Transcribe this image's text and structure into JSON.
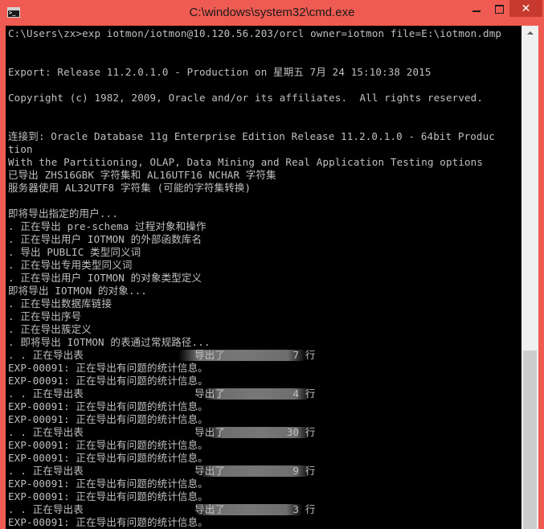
{
  "window": {
    "title": "C:\\windows\\system32\\cmd.exe",
    "icon": "cmd-console-icon",
    "controls": {
      "minimize_icon": "minimize-icon",
      "maximize_icon": "maximize-icon",
      "close_label": "✕"
    }
  },
  "console": {
    "lines": [
      "C:\\Users\\zx>exp iotmon/iotmon@10.120.56.203/orcl owner=iotmon file=E:\\iotmon.dmp",
      "",
      "",
      "Export: Release 11.2.0.1.0 - Production on 星期五 7月 24 15:10:38 2015",
      "",
      "Copyright (c) 1982, 2009, Oracle and/or its affiliates.  All rights reserved.",
      "",
      "",
      "连接到: Oracle Database 11g Enterprise Edition Release 11.2.0.1.0 - 64bit Produc",
      "tion",
      "With the Partitioning, OLAP, Data Mining and Real Application Testing options",
      "已导出 ZHS16GBK 字符集和 AL16UTF16 NCHAR 字符集",
      "服务器使用 AL32UTF8 字符集 (可能的字符集转换)",
      "",
      "即将导出指定的用户...",
      ". 正在导出 pre-schema 过程对象和操作",
      ". 正在导出用户 IOTMON 的外部函数库名",
      ". 导出 PUBLIC 类型同义词",
      ". 正在导出专用类型同义词",
      ". 正在导出用户 IOTMON 的对象类型定义",
      "即将导出 IOTMON 的对象...",
      ". 正在导出数据库链接",
      ". 正在导出序号",
      ". 正在导出簇定义",
      ". 即将导出 IOTMON 的表通过常规路径...",
      ". . 正在导出表                  导出了           7 行",
      "EXP-00091: 正在导出有问题的统计信息。",
      "EXP-00091: 正在导出有问题的统计信息。",
      ". . 正在导出表                  导出了           4 行",
      "EXP-00091: 正在导出有问题的统计信息。",
      "EXP-00091: 正在导出有问题的统计信息。",
      ". . 正在导出表                  导出了          30 行",
      "EXP-00091: 正在导出有问题的统计信息。",
      "EXP-00091: 正在导出有问题的统计信息。",
      ". . 正在导出表                  导出了           9 行",
      "EXP-00091: 正在导出有问题的统计信息。",
      "EXP-00091: 正在导出有问题的统计信息。",
      ". . 正在导出表                  导出了           3 行",
      "EXP-00091: 正在导出有问题的统计信息。"
    ]
  },
  "colors": {
    "title_bar": "#ef5b52",
    "close_button": "#c7392f",
    "console_bg": "#000000",
    "console_text": "#c0c0c0",
    "scrollbar_bg": "#f0f0f0",
    "scrollbar_thumb": "#cdcdcd"
  }
}
